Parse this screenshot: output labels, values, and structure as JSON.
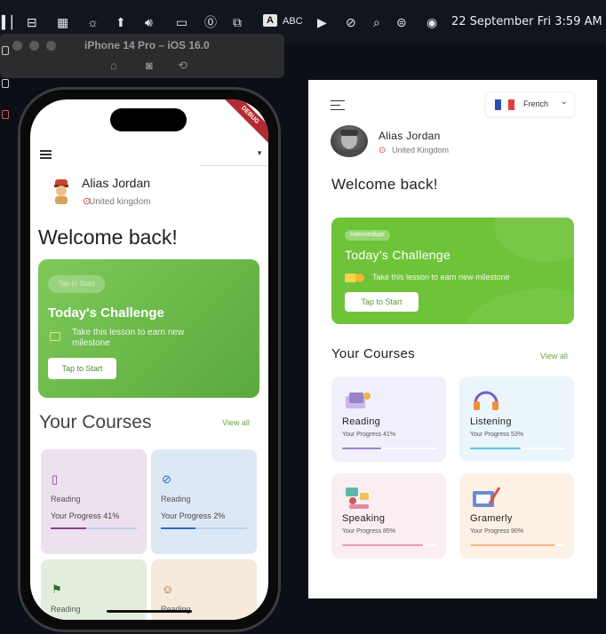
{
  "menubar": {
    "abc_badge": "A",
    "abc_label": "ABC",
    "datetime": "22 September Fri  3:59 AM"
  },
  "simulator": {
    "title": "iPhone 14 Pro – iOS 16.0"
  },
  "phone": {
    "debug_banner": "DEBUG",
    "user_name": "Alias Jordan",
    "location": "United kingdom",
    "welcome": "Welcome back!",
    "challenge": {
      "tag": "Tap to Start",
      "title": "Today's Challenge",
      "description": "Take this lesson to earn new milestone",
      "button": "Tap to Start"
    },
    "courses_title": "Your Courses",
    "view_all": "View all",
    "courses": [
      {
        "title": "Reading",
        "progress_label": "Your Progress 41%",
        "progress": 0.41,
        "icon": "book-icon",
        "bg": "#ede0ef",
        "accent": "#8a3e91"
      },
      {
        "title": "Reading",
        "progress_label": "Your Progress 2%",
        "progress": 0.4,
        "icon": "compass-icon",
        "bg": "#dde8f7",
        "accent": "#2a6ac7"
      },
      {
        "title": "Reading",
        "icon": "flag-icon",
        "bg": "#e2eedd",
        "accent": "#2e6b2a"
      },
      {
        "title": "Reading",
        "icon": "smile-icon",
        "bg": "#f6eadb",
        "accent": "#a0621d"
      }
    ]
  },
  "card": {
    "language": "French",
    "user_name": "Alias Jordan",
    "location": "United Kingdom",
    "welcome": "Welcome back!",
    "challenge": {
      "tag": "Intermediate",
      "title": "Today's Challenge",
      "description": "Take this lesson to earn new milestone",
      "button": "Tap to Start"
    },
    "courses_title": "Your Courses",
    "view_all": "View all",
    "courses": [
      {
        "title": "Reading",
        "progress_label": "Your Progress 41%",
        "progress": 0.41,
        "icon": "reading-illustration-icon",
        "bg": "#f1effb",
        "accent": "#9a83c9"
      },
      {
        "title": "Listening",
        "progress_label": "Your Progress 53%",
        "progress": 0.53,
        "icon": "headphones-illustration-icon",
        "bg": "#eaf6fb",
        "accent": "#5cc5e0"
      },
      {
        "title": "Speaking",
        "progress_label": "Your Progress 85%",
        "progress": 0.85,
        "icon": "speaking-illustration-icon",
        "bg": "#fbeef2",
        "accent": "#ee98b0"
      },
      {
        "title": "Gramerly",
        "progress_label": "Your Progress 90%",
        "progress": 0.9,
        "icon": "grammar-illustration-icon",
        "bg": "#fdf1e6",
        "accent": "#f3b988"
      }
    ]
  },
  "colors": {
    "green": "#6fc339",
    "view_all": "#6ba34a",
    "pin": "#d23b3b"
  }
}
